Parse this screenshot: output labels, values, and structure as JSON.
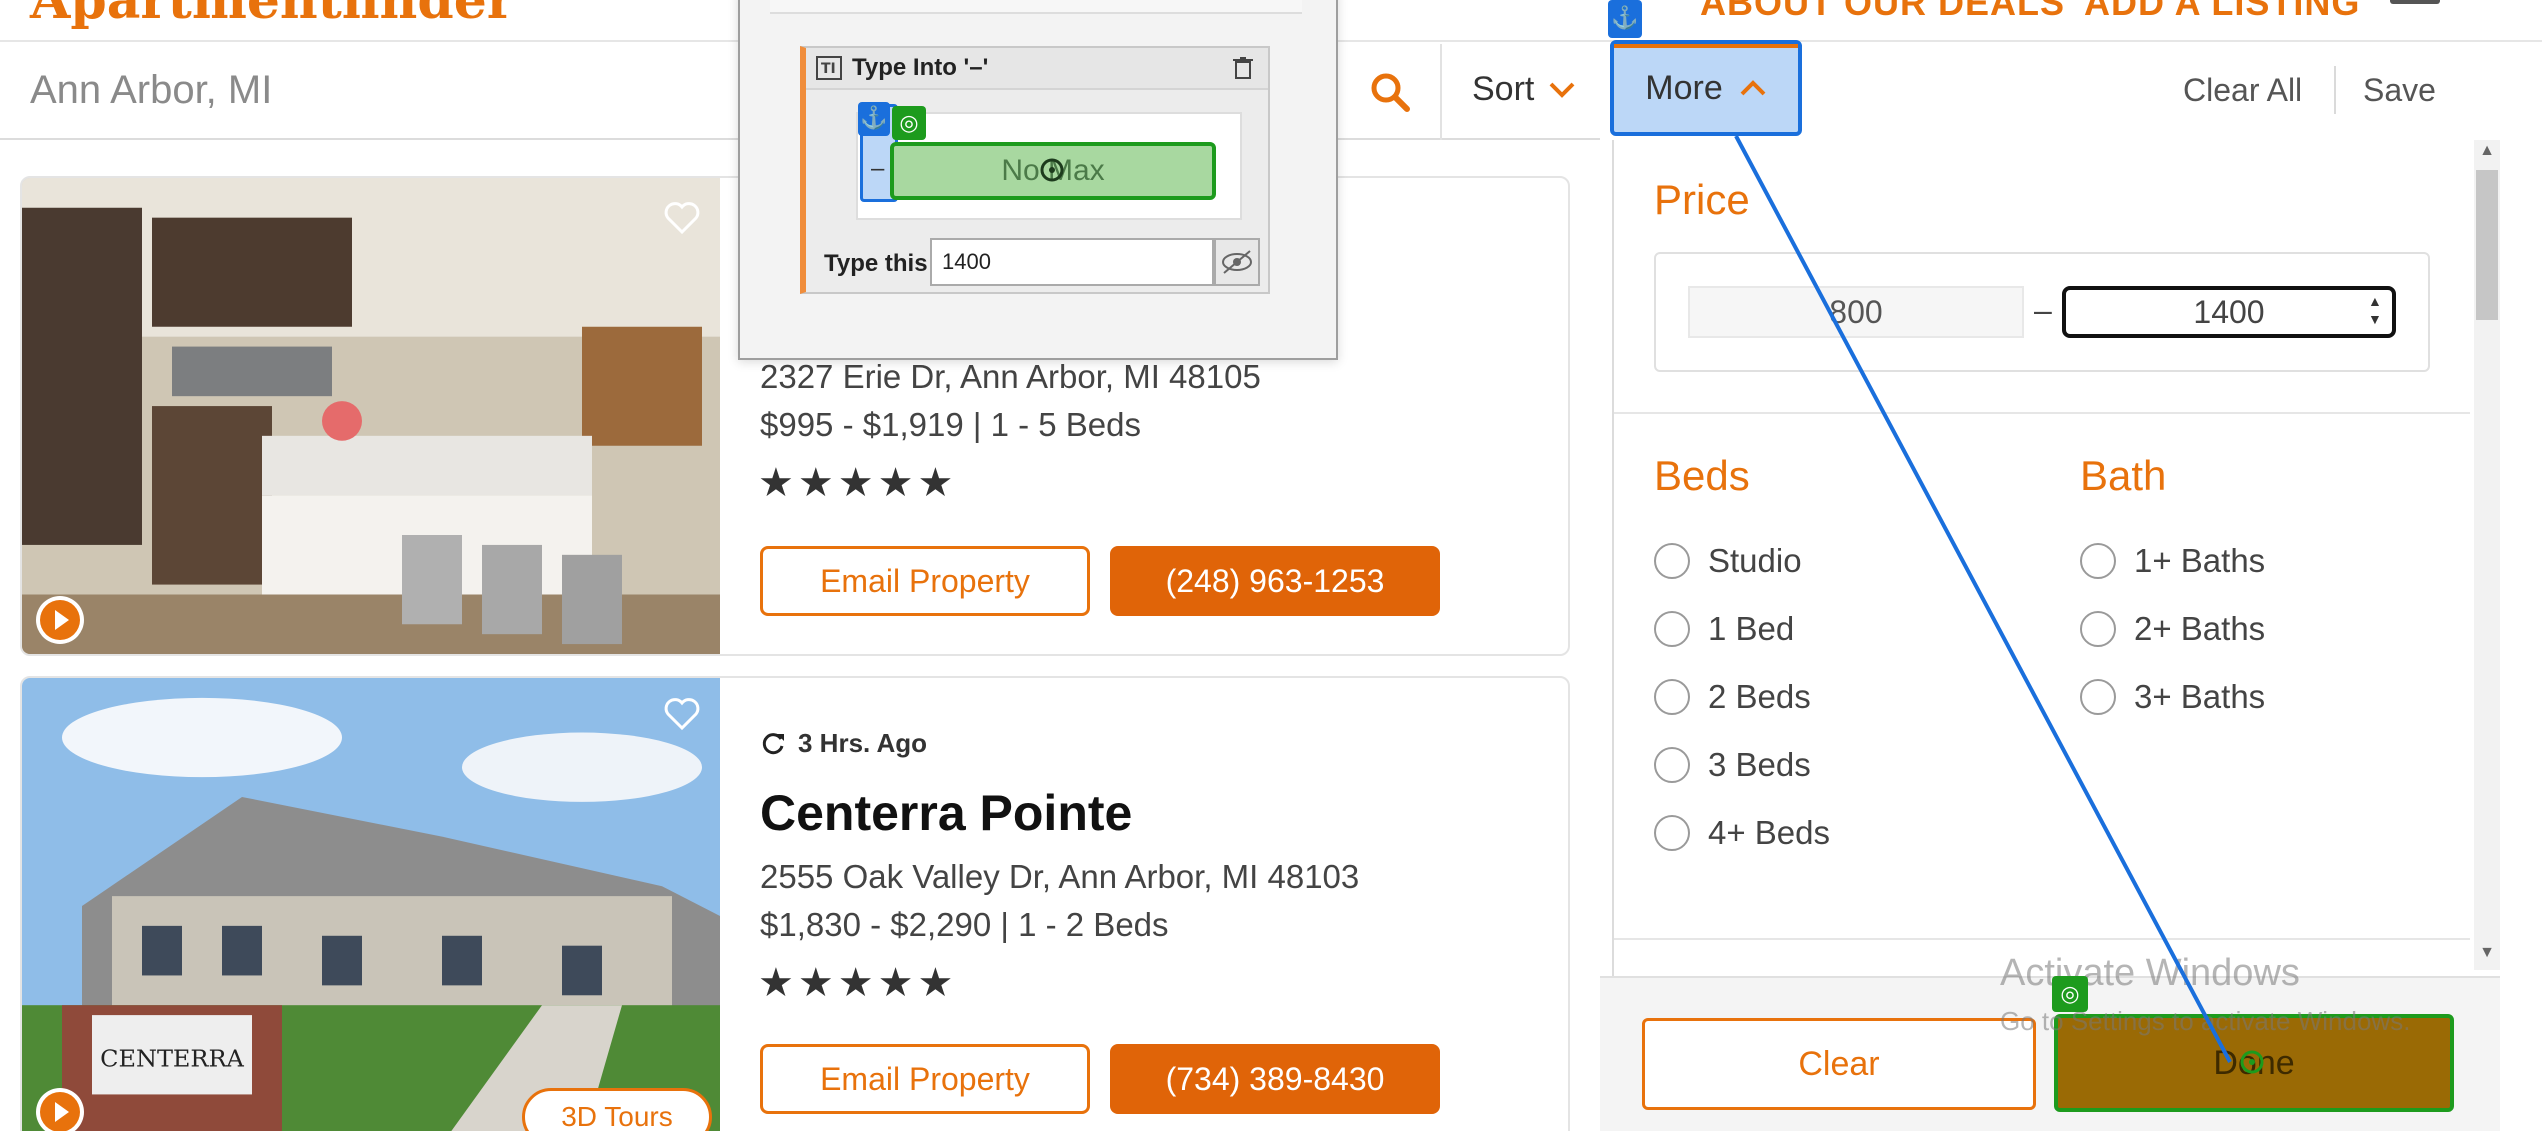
{
  "header": {
    "logo_text": "Apartmentfinder",
    "nav_deals": "ABOUT OUR DEALS",
    "nav_add_listing": "ADD A LISTING"
  },
  "search": {
    "location": "Ann Arbor, MI",
    "sort_label": "Sort",
    "more_label": "More",
    "clear_all_label": "Clear All",
    "save_label": "Save"
  },
  "listings": [
    {
      "address": "2327 Erie Dr, Ann Arbor, MI 48105",
      "price_beds": "$995 - $1,919 | 1 - 5 Beds",
      "stars": "★★★★★",
      "email_label": "Email Property",
      "phone": "(248) 963-1253"
    },
    {
      "updated": "3 Hrs. Ago",
      "name": "Centerra Pointe",
      "address": "2555 Oak Valley Dr, Ann Arbor, MI 48103",
      "price_beds": "$1,830 - $2,290 | 1 - 2 Beds",
      "stars": "★★★★★",
      "email_label": "Email Property",
      "phone": "(734) 389-8430",
      "badge": "3D Tours"
    }
  ],
  "filters": {
    "price_title": "Price",
    "price_min": "800",
    "price_dash": "–",
    "price_max": "1400",
    "beds_title": "Beds",
    "beds_options": [
      "Studio",
      "1 Bed",
      "2 Beds",
      "3 Beds",
      "4+ Beds"
    ],
    "bath_title": "Bath",
    "bath_options": [
      "1+ Baths",
      "2+ Baths",
      "3+ Baths"
    ],
    "clear_label": "Clear",
    "done_label": "Done"
  },
  "automation": {
    "step_title": "Type Into '–'",
    "anchor_text": "–",
    "target_text": "No Max",
    "type_label": "Type this",
    "type_value": "1400"
  },
  "watermark": {
    "line1": "Activate Windows",
    "line2": "Go to Settings to activate Windows."
  },
  "colors": {
    "brand": "#e8720c",
    "phone_button": "#e06408",
    "anchor_blue": "#1a6fdc",
    "target_green": "#1d9b1d"
  }
}
